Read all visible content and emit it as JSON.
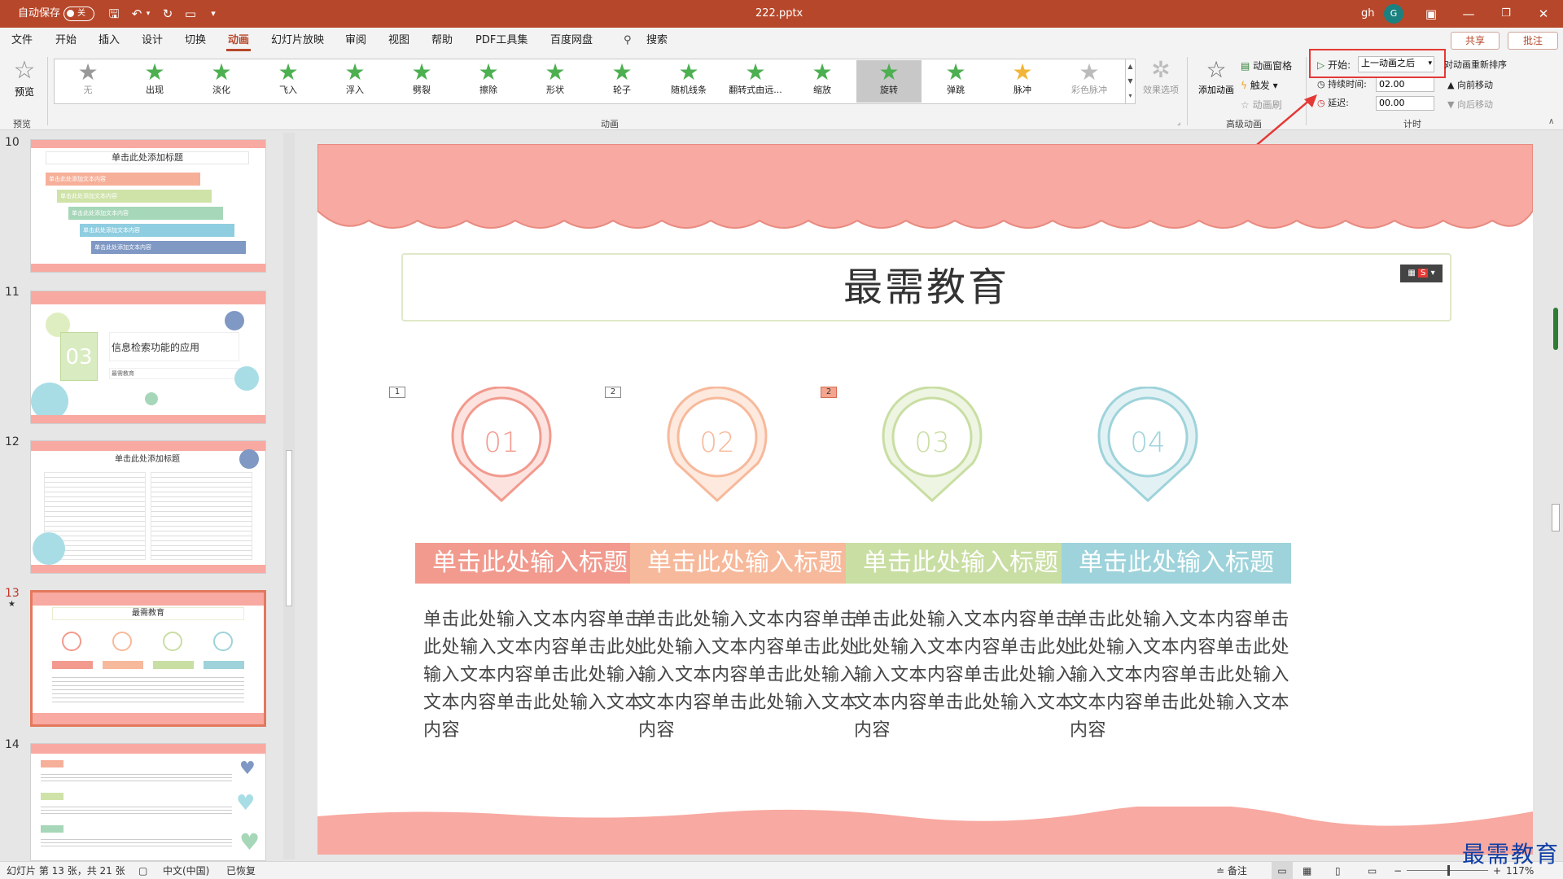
{
  "titlebar": {
    "autosave": "自动保存",
    "toggle_state": "关",
    "filename": "222.pptx",
    "user": "gh",
    "avatar_initial": "G"
  },
  "menu": {
    "tabs": [
      "文件",
      "开始",
      "插入",
      "设计",
      "切换",
      "动画",
      "幻灯片放映",
      "审阅",
      "视图",
      "帮助",
      "PDF工具集",
      "百度网盘"
    ],
    "active": "动画",
    "search": "搜索",
    "share": "共享",
    "comment": "批注"
  },
  "ribbon": {
    "preview": "预览",
    "preview_group": "预览",
    "animations": [
      "无",
      "出现",
      "淡化",
      "飞入",
      "浮入",
      "劈裂",
      "擦除",
      "形状",
      "轮子",
      "随机线条",
      "翻转式由远...",
      "缩放",
      "旋转",
      "弹跳",
      "脉冲",
      "彩色脉冲"
    ],
    "selected_animation": "旋转",
    "effect_options": "效果选项",
    "animation_group": "动画",
    "add_animation": "添加动画",
    "animation_pane": "动画窗格",
    "trigger": "触发",
    "animation_painter": "动画刷",
    "advanced_group": "高级动画",
    "start_label": "开始:",
    "start_value": "上一动画之后",
    "duration_label": "持续时间:",
    "duration_value": "02.00",
    "delay_label": "延迟:",
    "delay_value": "00.00",
    "reorder": "对动画重新排序",
    "move_earlier": "向前移动",
    "move_later": "向后移动",
    "timing_group": "计时"
  },
  "thumbnails": [
    {
      "num": "10",
      "title": "单击此处添加标题",
      "items": [
        "单击此处添加文本内容",
        "单击此处添加文本内容",
        "单击此处添加文本内容",
        "单击此处添加文本内容",
        "单击此处添加文本内容"
      ]
    },
    {
      "num": "11",
      "number": "03",
      "heading": "信息检索功能的应用",
      "caption": "最需教育"
    },
    {
      "num": "12",
      "title": "单击此处添加标题"
    },
    {
      "num": "13",
      "title": "最需教育",
      "star": "★"
    },
    {
      "num": "14"
    }
  ],
  "slide": {
    "title": "最需教育",
    "badges": [
      "1",
      "2",
      "2"
    ],
    "pins": [
      {
        "num": "01",
        "color": "#f29a8e",
        "light": "#fce3df",
        "header": "单击此处输入标题"
      },
      {
        "num": "02",
        "color": "#f7b99b",
        "light": "#fde9dd",
        "header": "单击此处输入标题"
      },
      {
        "num": "03",
        "color": "#c9dea3",
        "light": "#eef5e2",
        "header": "单击此处输入标题"
      },
      {
        "num": "04",
        "color": "#9ed3db",
        "light": "#e2f2f4",
        "header": "单击此处输入标题"
      }
    ],
    "body": "单击此处输入文本内容单击此处输入文本内容单击此处输入文本内容单击此处输入文本内容单击此处输入文本内容"
  },
  "status": {
    "slide_info": "幻灯片 第 13 张，共 21 张",
    "language": "中文(中国)",
    "recovered": "已恢复",
    "notes": "备注",
    "zoom": "117%"
  },
  "watermark": "最需教育",
  "colors": {
    "accent": "#b7472a",
    "scallop": "#f8a9a1",
    "highlight_box": "#e53935"
  }
}
